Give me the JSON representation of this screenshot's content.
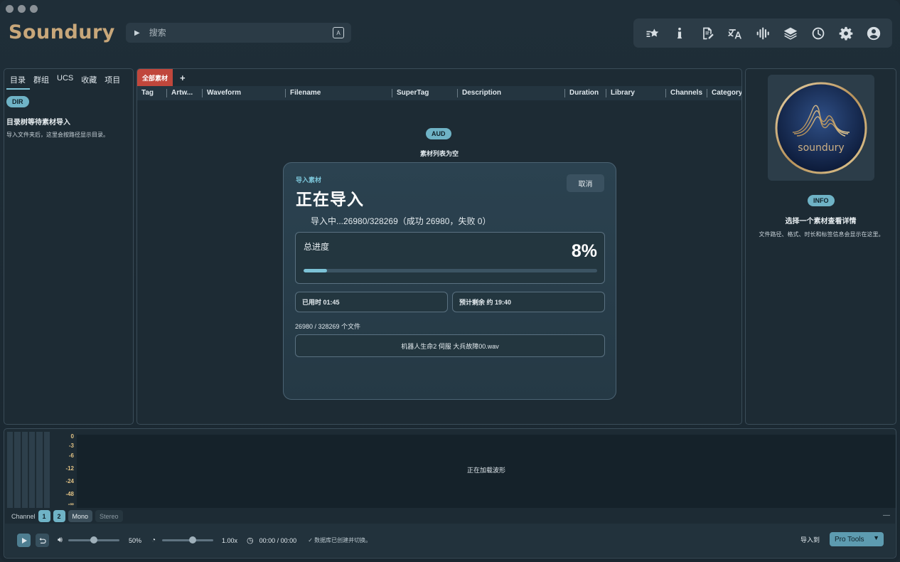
{
  "app": {
    "name": "Soundury"
  },
  "search": {
    "placeholder": "搜索"
  },
  "left_panel": {
    "tabs": [
      "目录",
      "群组",
      "UCS",
      "收藏",
      "项目"
    ],
    "badge": "DIR",
    "title": "目录树等待素材导入",
    "subtitle": "导入文件夹后，这里会按路径显示目录。"
  },
  "center_panel": {
    "active_tab": "全部素材",
    "add_tab": "+",
    "columns": [
      "Tag",
      "Artw...",
      "Waveform",
      "Filename",
      "SuperTag",
      "Description",
      "Duration",
      "Library",
      "Channels",
      "Category"
    ],
    "badge": "AUD",
    "empty_text": "素材列表为空"
  },
  "import_dialog": {
    "subtitle": "导入素材",
    "title": "正在导入",
    "cancel_label": "取消",
    "status": "导入中...26980/328269（成功 26980，失败 0）",
    "progress_label": "总进度",
    "progress_percent_text": "8%",
    "progress_fraction": 0.08,
    "elapsed": "已用时  01:45",
    "remaining": "预计剩余  约 19:40",
    "file_count": "26980 / 328269 个文件",
    "current_file": "机器人生命2 伺服 大兵故障00.wav"
  },
  "right_panel": {
    "logo_text": "soundury",
    "badge": "INFO",
    "title": "选择一个素材查看详情",
    "subtitle": "文件路径、格式、时长和标签信息会显示在这里。"
  },
  "meter_scale": [
    "0",
    "-3",
    "-6",
    "-12",
    "-24",
    "-48",
    "-∞"
  ],
  "waveform": {
    "message": "正在加载波形"
  },
  "channel": {
    "label": "Channel",
    "ch1": "1",
    "ch2": "2",
    "mono": "Mono",
    "stereo": "Stereo"
  },
  "transport": {
    "volume_text": "50%",
    "volume_fraction": 0.5,
    "speed_text": "1.00x",
    "speed_fraction": 0.6,
    "time": "00:00 / 00:00",
    "status": "✓ 数据库已创建并切换。",
    "import_to_label": "导入到",
    "import_target": "Pro Tools"
  },
  "colors": {
    "accent": "#6fb3c6",
    "tab_active": "#c0473c",
    "logo": "#c8a77a",
    "meter_scale": "#e1c285"
  }
}
